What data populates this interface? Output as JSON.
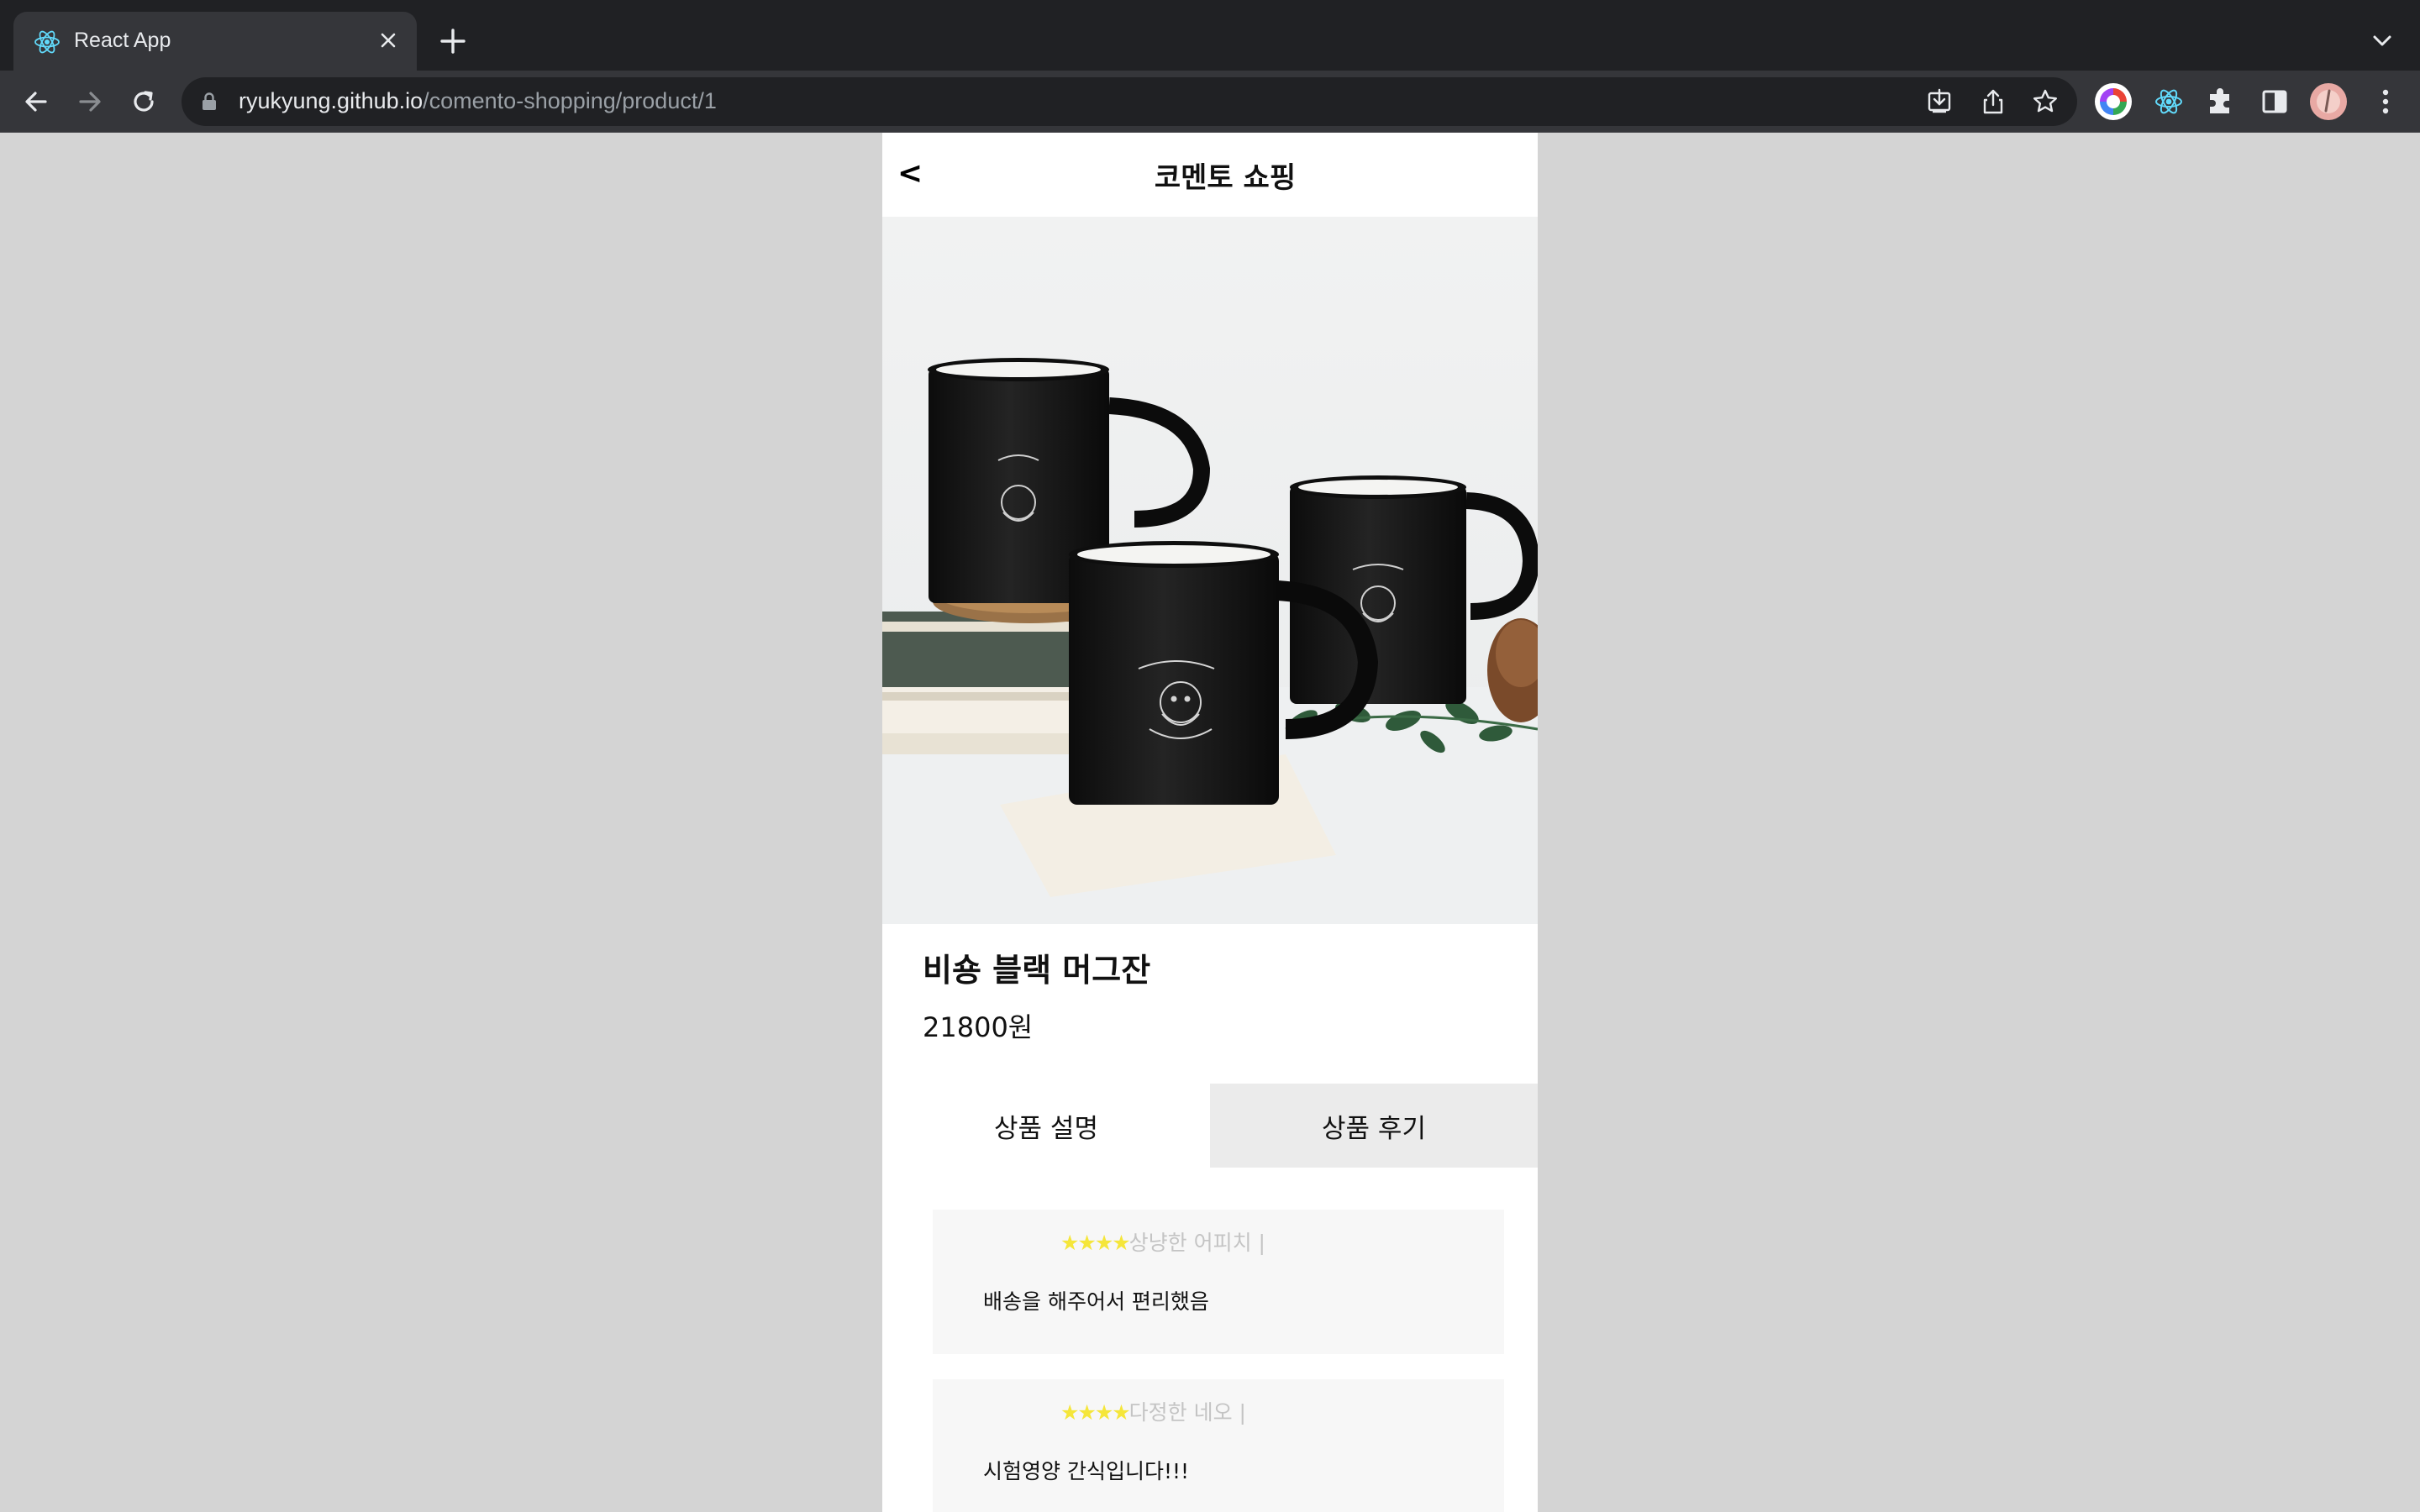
{
  "browser": {
    "tab_title": "React App",
    "url_host": "ryukyung.github.io",
    "url_path": "/comento-shopping/product/1"
  },
  "app": {
    "title": "코멘토 쇼핑",
    "back_label": "<"
  },
  "product": {
    "name": "비숑 블랙 머그잔",
    "price": "21800원"
  },
  "tabs": [
    {
      "label": "상품 설명",
      "active": false
    },
    {
      "label": "상품 후기",
      "active": true
    }
  ],
  "reviews": [
    {
      "stars": "★★★★",
      "reviewer": "상냥한 어피치 |",
      "text": "배송을 해주어서 편리했음"
    },
    {
      "stars": "★★★★",
      "reviewer": "다정한 네오 |",
      "text": "시험영양 간식입니다!!!"
    }
  ],
  "colors": {
    "page_background": "#d4d4d4",
    "star": "#f5e63a",
    "active_tab": "#ebebeb",
    "review_card": "#f7f7f7"
  }
}
